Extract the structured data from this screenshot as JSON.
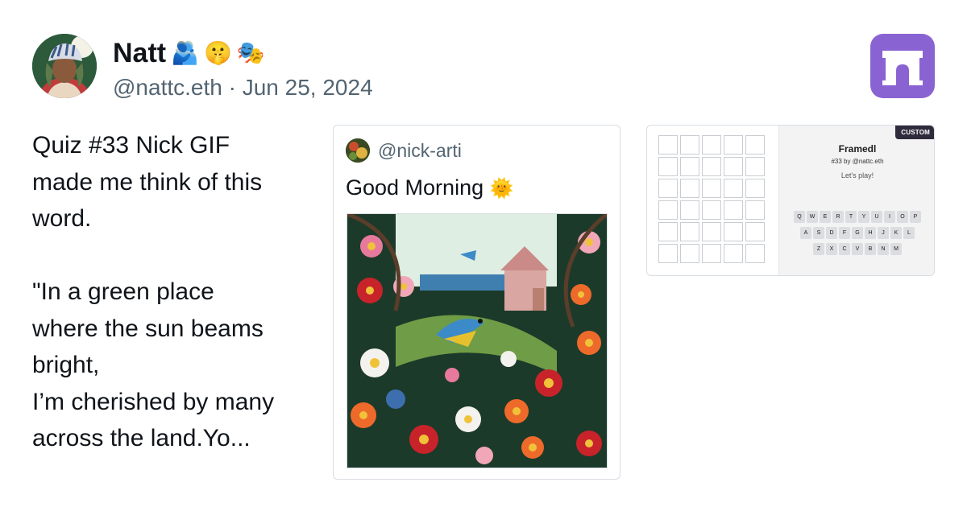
{
  "post": {
    "author_name": "Natt",
    "author_emojis": [
      "🫂",
      "🤫",
      "🎭"
    ],
    "handle": "@nattc.eth",
    "separator": "·",
    "date": "Jun 25, 2024",
    "text_lines": [
      "Quiz #33 Nick GIF",
      "made me think of this",
      "word.",
      "",
      "\"In a green place",
      "where the sun beams",
      "bright,",
      "I’m cherished by many",
      "across the land.Yo..."
    ]
  },
  "quote": {
    "handle": "@nick-arti",
    "text": "Good Morning",
    "text_emoji": "🌞"
  },
  "frame": {
    "badge": "CUSTOM",
    "title": "Framedl",
    "subtitle": "#33 by @nattc.eth",
    "prompt": "Let's play!",
    "grid_rows": 6,
    "grid_cols": 5,
    "keyboard": [
      [
        "Q",
        "W",
        "E",
        "R",
        "T",
        "Y",
        "U",
        "I",
        "O",
        "P"
      ],
      [
        "A",
        "S",
        "D",
        "F",
        "G",
        "H",
        "J",
        "K",
        "L"
      ],
      [
        "Z",
        "X",
        "C",
        "V",
        "B",
        "N",
        "M"
      ]
    ]
  },
  "colors": {
    "app_logo": "#8a63d2",
    "text_primary": "#0f1419",
    "text_secondary": "#536471",
    "border": "#d8dde2"
  },
  "icons": {
    "app_logo": "farcaster-arch-icon"
  }
}
